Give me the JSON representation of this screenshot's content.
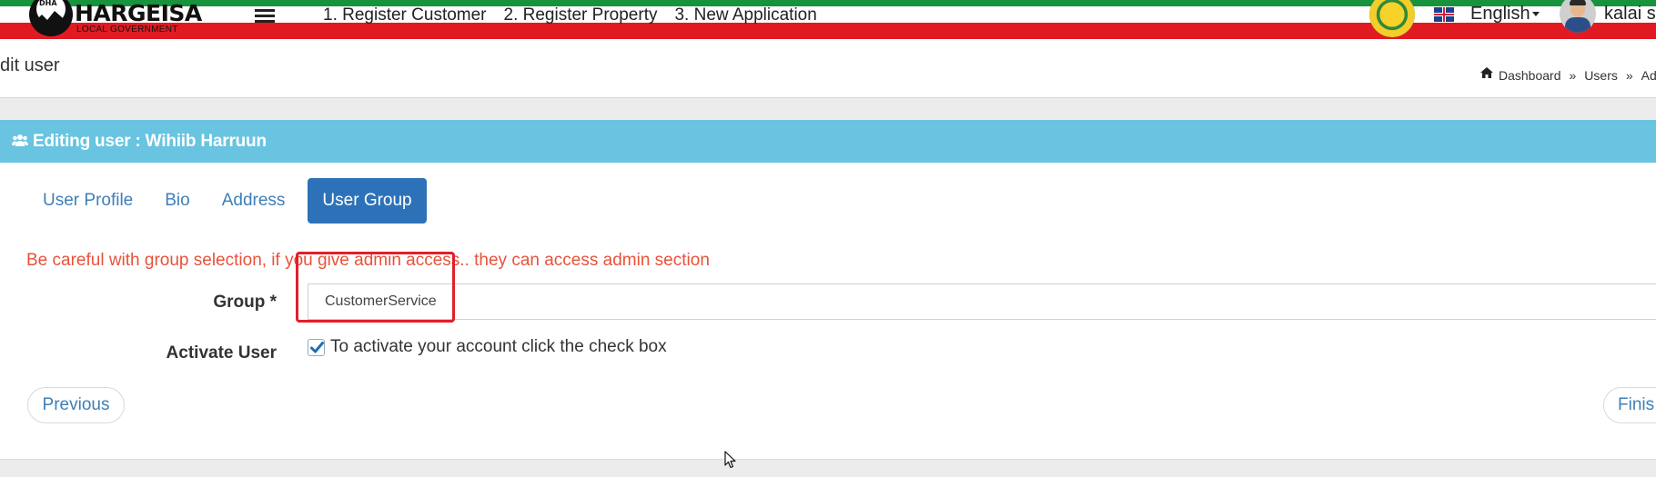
{
  "header": {
    "logo_title": "HARGEISA",
    "logo_subtitle": "LOCAL GOVERNMENT",
    "logo_emblem_text": "DHA",
    "nav": [
      "1. Register Customer",
      "2. Register Property",
      "3. New Application"
    ],
    "language": "English",
    "username": "kalai s"
  },
  "page": {
    "title": "dit user",
    "breadcrumb": [
      "Dashboard",
      "Users",
      "Add"
    ],
    "breadcrumb_sep": "»"
  },
  "panel": {
    "title": "Editing user : Wihiib Harruun",
    "tabs": [
      {
        "label": "User Profile",
        "active": false
      },
      {
        "label": "Bio",
        "active": false
      },
      {
        "label": "Address",
        "active": false
      },
      {
        "label": "User Group",
        "active": true
      }
    ],
    "warning": "Be careful with group selection, if you give admin access.. they can access admin section",
    "group_label": "Group *",
    "group_value": "CustomerService",
    "activate_label": "Activate User",
    "activate_checked": true,
    "activate_text": "To activate your account click the check box",
    "prev_button": "Previous",
    "finish_button": "Finis"
  },
  "colors": {
    "flag_green": "#17923d",
    "flag_red": "#e11a22",
    "panel_header": "#68c4e0",
    "active_tab": "#2d72b8",
    "link": "#3e7fb8",
    "warning": "#e8523b",
    "highlight_box": "#e11f2b"
  },
  "icons": [
    "hamburger-icon",
    "seal-icon",
    "uk-flag-icon",
    "caret-down-icon",
    "avatar",
    "home-icon",
    "users-icon",
    "check-icon",
    "mouse-cursor-icon"
  ]
}
